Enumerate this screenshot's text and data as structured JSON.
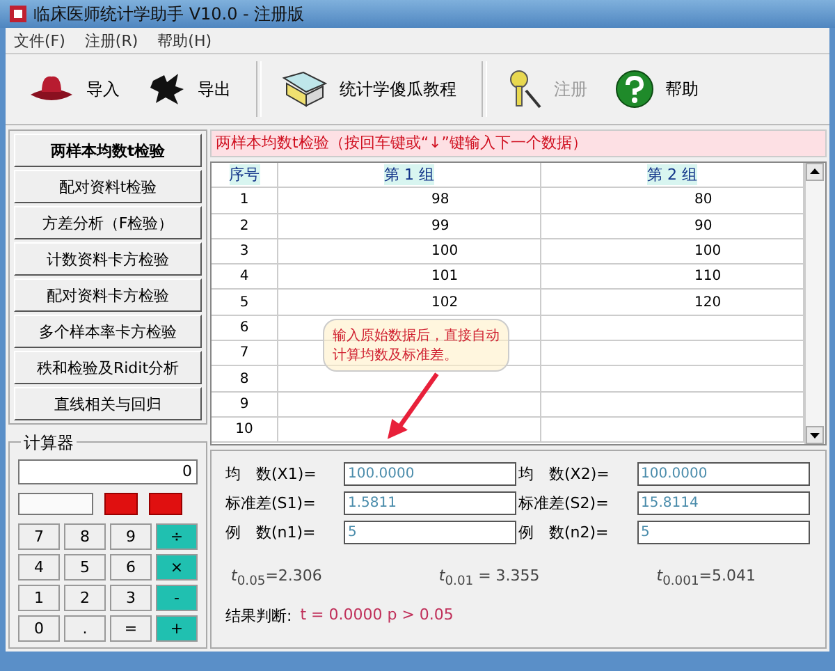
{
  "window": {
    "title": "临床医师统计学助手 V10.0 - 注册版"
  },
  "menu": [
    "文件(F)",
    "注册(R)",
    "帮助(H)"
  ],
  "toolbar": [
    {
      "label": "导入",
      "kind": "import",
      "disabled": false
    },
    {
      "label": "导出",
      "kind": "export",
      "disabled": false
    },
    {
      "label": "统计学傻瓜教程",
      "kind": "tutorial",
      "disabled": false
    },
    {
      "label": "注册",
      "kind": "register",
      "disabled": true
    },
    {
      "label": "帮助",
      "kind": "help",
      "disabled": false
    }
  ],
  "tests": [
    {
      "label": "两样本均数t检验",
      "selected": true
    },
    {
      "label": "配对资料t检验",
      "selected": false
    },
    {
      "label": "方差分析（F检验）",
      "selected": false
    },
    {
      "label": "计数资料卡方检验",
      "selected": false
    },
    {
      "label": "配对资料卡方检验",
      "selected": false
    },
    {
      "label": "多个样本率卡方检验",
      "selected": false
    },
    {
      "label": "秩和检验及Ridit分析",
      "selected": false
    },
    {
      "label": "直线相关与回归",
      "selected": false
    }
  ],
  "panel_title": "两样本均数t检验（按回车键或“↓”键输入下一个数据）",
  "table": {
    "columns": [
      "序号",
      "第 1 组",
      "第 2 组"
    ],
    "rows": [
      {
        "cells": [
          "1",
          "98",
          "80"
        ]
      },
      {
        "cells": [
          "2",
          "99",
          "90"
        ]
      },
      {
        "cells": [
          "3",
          "100",
          "100"
        ]
      },
      {
        "cells": [
          "4",
          "101",
          "110"
        ]
      },
      {
        "cells": [
          "5",
          "102",
          "120"
        ]
      },
      {
        "cells": [
          "6"
        ]
      },
      {
        "cells": [
          "7"
        ]
      },
      {
        "cells": [
          "8"
        ]
      },
      {
        "cells": [
          "9"
        ]
      },
      {
        "cells": [
          "10"
        ]
      }
    ]
  },
  "callout": {
    "lines": [
      "输入原始数据后，直接自动",
      "计算均数及标准差。"
    ]
  },
  "calculator": {
    "title": "计算器",
    "display": "0",
    "keys": [
      {
        "kind": "clear"
      },
      {
        "kind": "clear"
      },
      {
        "label": "7",
        "kind": "digit"
      },
      {
        "label": "8",
        "kind": "digit"
      },
      {
        "label": "9",
        "kind": "digit"
      },
      {
        "label": "÷",
        "kind": "op"
      },
      {
        "label": "4",
        "kind": "digit"
      },
      {
        "label": "5",
        "kind": "digit"
      },
      {
        "label": "6",
        "kind": "digit"
      },
      {
        "label": "×",
        "kind": "op"
      },
      {
        "label": "1",
        "kind": "digit"
      },
      {
        "label": "2",
        "kind": "digit"
      },
      {
        "label": "3",
        "kind": "digit"
      },
      {
        "label": "-",
        "kind": "op"
      },
      {
        "label": "0",
        "kind": "digit"
      },
      {
        "label": ".",
        "kind": "digit"
      },
      {
        "label": "=",
        "kind": "digit"
      },
      {
        "label": "+",
        "kind": "op"
      }
    ]
  },
  "results": {
    "fields": [
      {
        "label": "均　数(X1)=",
        "value": "100.0000"
      },
      {
        "label": "均　数(X2)=",
        "value": "100.0000"
      },
      {
        "label": "标准差(S1)=",
        "value": "1.5811"
      },
      {
        "label": "标准差(S2)=",
        "value": "15.8114"
      },
      {
        "label": "例　数(n1)=",
        "value": "5"
      },
      {
        "label": "例　数(n2)=",
        "value": "5"
      }
    ],
    "critical": [
      "*t*$_{0.05}$=2.306",
      "*t*$_{0.01}$ = 3.355",
      "*t*$_{0.001}$=5.041"
    ],
    "conclusion_label": "结果判断:",
    "conclusion": "t = 0.0000   p > 0.05"
  }
}
